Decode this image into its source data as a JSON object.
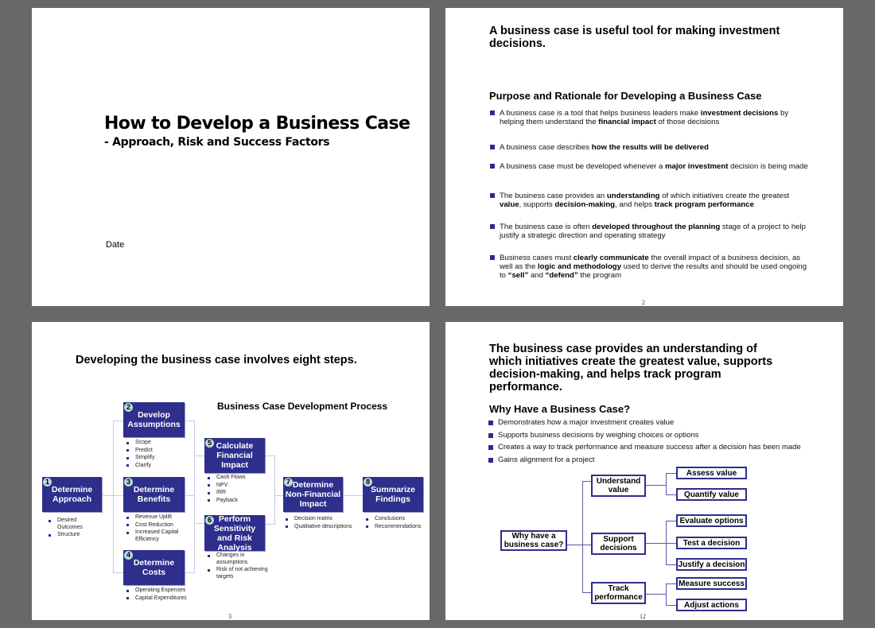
{
  "colors": {
    "background": "#686868",
    "accent": "#2e2e8c",
    "badge": "#b8dcd8"
  },
  "slide1": {
    "title": "How to Develop a Business Case",
    "subtitle": "- Approach, Risk and Success Factors",
    "date_label": "Date"
  },
  "slide2": {
    "heading": "A business case is useful tool for making investment decisions.",
    "subheading": "Purpose and Rationale for Developing a Business Case",
    "bullets": [
      [
        {
          "t": "A business case is a tool that helps business leaders make "
        },
        {
          "t": "investment decisions",
          "b": true
        },
        {
          "t": " by helping them understand the "
        },
        {
          "t": "financial impact",
          "b": true
        },
        {
          "t": " of those decisions"
        }
      ],
      [
        {
          "t": "A business case describes "
        },
        {
          "t": "how the results will be delivered",
          "b": true
        }
      ],
      [
        {
          "t": "A business case must be developed whenever a "
        },
        {
          "t": "major investment",
          "b": true
        },
        {
          "t": " decision is being made"
        }
      ],
      [
        {
          "t": "The business case provides an "
        },
        {
          "t": "understanding",
          "b": true
        },
        {
          "t": " of which initiatives create the greatest "
        },
        {
          "t": "value",
          "b": true
        },
        {
          "t": ", supports "
        },
        {
          "t": "decision-making",
          "b": true
        },
        {
          "t": ", and helps "
        },
        {
          "t": "track program performance",
          "b": true
        }
      ],
      [
        {
          "t": "The business case is often "
        },
        {
          "t": "developed throughout the planning",
          "b": true
        },
        {
          "t": " stage of a project to help justify a strategic direction and operating strategy"
        }
      ],
      [
        {
          "t": "Business cases must "
        },
        {
          "t": "clearly communicate",
          "b": true
        },
        {
          "t": " the overall impact of a business decision, as well as the "
        },
        {
          "t": "logic and methodology",
          "b": true
        },
        {
          "t": " used to derive the results and should be used ongoing to "
        },
        {
          "t": "“sell”",
          "b": true
        },
        {
          "t": " and "
        },
        {
          "t": "“defend”",
          "b": true
        },
        {
          "t": " the program"
        }
      ]
    ],
    "page_number": "2"
  },
  "slide3": {
    "heading": "Developing the business case involves eight steps.",
    "diagram_title": "Business Case Development Process",
    "steps": [
      {
        "num": "1",
        "label": "Determine Approach",
        "items": [
          "Desired Outcomes",
          "Structure"
        ]
      },
      {
        "num": "2",
        "label": "Develop Assumptions",
        "items": [
          "Scope",
          "Predict",
          "Simplify",
          "Clarify"
        ]
      },
      {
        "num": "3",
        "label": "Determine Benefits",
        "items": [
          "Revenue Uplift",
          "Cost Reduction",
          "Increased Capital Efficiency"
        ]
      },
      {
        "num": "4",
        "label": "Determine Costs",
        "items": [
          "Operating Expenses",
          "Capital Expenditures"
        ]
      },
      {
        "num": "5",
        "label": "Calculate Financial Impact",
        "items": [
          "Cash Flows",
          "NPV",
          "IRR",
          "Payback"
        ]
      },
      {
        "num": "6",
        "label": "Perform Sensitivity and Risk Analysis",
        "items": [
          "Changes in assumptions",
          "Risk of not achieving targets"
        ]
      },
      {
        "num": "7",
        "label": "Determine Non-Financial Impact",
        "items": [
          "Decision matrix",
          "Qualitative descriptions"
        ]
      },
      {
        "num": "8",
        "label": "Summarize Findings",
        "items": [
          "Conclusions",
          "Recommendations"
        ]
      }
    ],
    "page_number": "3"
  },
  "slide4": {
    "heading": "The business case provides an understanding of which initiatives create the greatest value, supports decision-making, and helps track program performance.",
    "subheading": "Why Have a Business Case?",
    "bullets": [
      "Demonstrates how a major investment creates value",
      "Supports business decisions by weighing choices or options",
      "Creates a way to track performance and measure success after a decision has been made",
      "Gains alignment for a project"
    ],
    "tree": {
      "root": "Why have a business case?",
      "branches": [
        {
          "label": "Understand value",
          "leaves": [
            "Assess value",
            "Quantify value"
          ]
        },
        {
          "label": "Support decisions",
          "leaves": [
            "Evaluate options",
            "Test a decision",
            "Justify a decision"
          ]
        },
        {
          "label": "Track performance",
          "leaves": [
            "Measure success",
            "Adjust actions"
          ]
        }
      ]
    },
    "page_number": "12"
  }
}
